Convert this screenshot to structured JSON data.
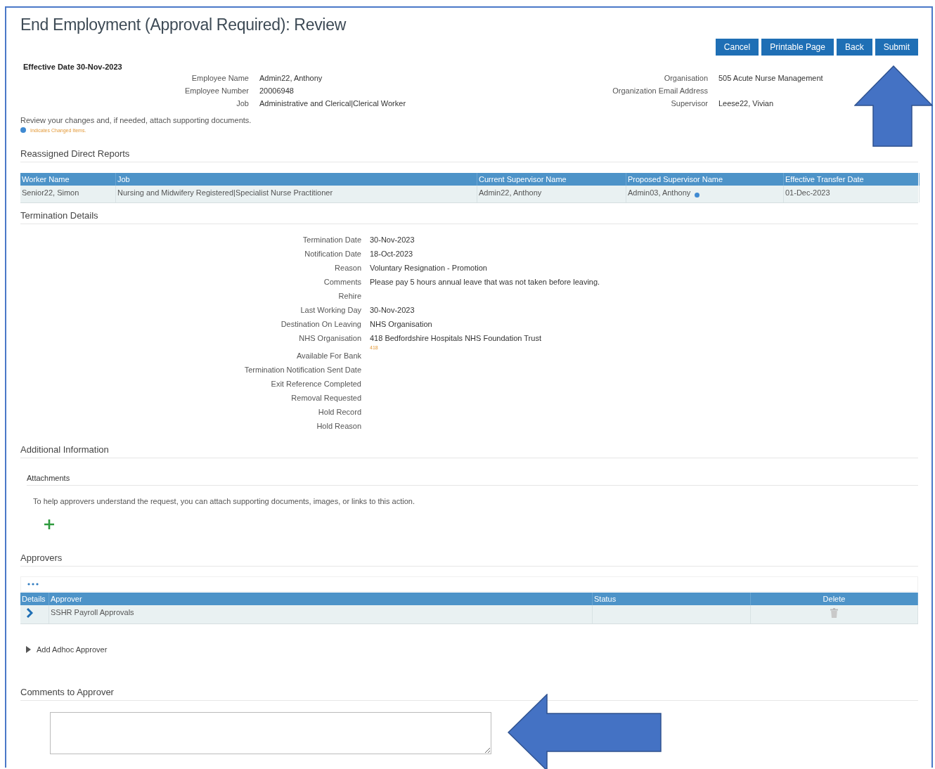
{
  "title": "End Employment (Approval Required): Review",
  "buttons": [
    "Cancel",
    "Printable Page",
    "Back",
    "Submit"
  ],
  "effective_date": "Effective Date 30-Nov-2023",
  "employee_info": [
    {
      "label": "Employee Name",
      "value": "Admin22, Anthony"
    },
    {
      "label": "Organisation",
      "value": "505 Acute Nurse Management"
    },
    {
      "label": "Employee Number",
      "value": "20006948"
    },
    {
      "label": "Organization Email Address"
    },
    {
      "label": "Job",
      "value": "Administrative and Clerical|Clerical Worker"
    },
    {
      "label": "Supervisor",
      "value": "Leese22, Vivian"
    }
  ],
  "review_note": "Review your changes and, if needed, attach supporting documents.",
  "legend": "Indicates Changed Items.",
  "reassigned": {
    "heading": "Reassigned Direct Reports",
    "columns": [
      "Worker Name",
      "Job",
      "Current Supervisor Name",
      "Proposed Supervisor Name",
      "Effective Transfer Date"
    ],
    "rows": [
      {
        "cells": [
          {
            "text": "Senior22, Simon",
            "changed": false
          },
          {
            "text": "Nursing and Midwifery Registered|Specialist Nurse Practitioner",
            "changed": false
          },
          {
            "text": "Admin22, Anthony",
            "changed": false
          },
          {
            "text": "Admin03, Anthony",
            "changed": true
          },
          {
            "text": "01-Dec-2023",
            "changed": false
          }
        ]
      }
    ]
  },
  "termination": {
    "heading": "Termination Details",
    "fields": [
      {
        "label": "Termination Date",
        "value": "30-Nov-2023"
      },
      {
        "label": "Notification Date",
        "value": "18-Oct-2023"
      },
      {
        "label": "Reason",
        "value": "Voluntary Resignation - Promotion"
      },
      {
        "label": "Comments",
        "value": "Please pay 5 hours annual leave that was not taken before leaving."
      },
      {
        "label": "Rehire"
      },
      {
        "label": "Last Working Day",
        "value": "30-Nov-2023"
      },
      {
        "label": "Destination On Leaving",
        "value": "NHS Organisation"
      },
      {
        "label": "NHS Organisation",
        "value": "418 Bedfordshire Hospitals NHS Foundation Trust",
        "note": "418"
      },
      {
        "label": "Available For Bank"
      },
      {
        "label": "Termination Notification Sent Date"
      },
      {
        "label": "Exit Reference Completed"
      },
      {
        "label": "Removal Requested"
      },
      {
        "label": "Hold Record"
      },
      {
        "label": "Hold Reason"
      }
    ]
  },
  "additional": {
    "heading": "Additional Information",
    "attachments_heading": "Attachments",
    "hint": "To help approvers understand the request, you can attach supporting documents, images, or links to this action."
  },
  "approvers": {
    "heading": "Approvers",
    "columns": [
      "Details",
      "Approver",
      "Status",
      "Delete"
    ],
    "rows": [
      {
        "approver": "SSHR Payroll Approvals"
      }
    ]
  },
  "adhoc": {
    "label": "Add Adhoc Approver",
    "expanded": false
  },
  "comments": {
    "heading": "Comments to Approver"
  },
  "annotations": [
    {
      "kind": "up"
    },
    {
      "kind": "left"
    }
  ]
}
